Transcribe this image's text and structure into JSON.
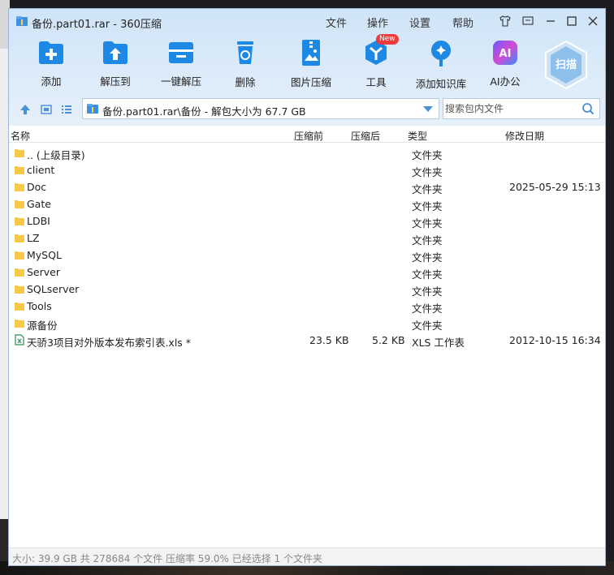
{
  "window": {
    "title": "备份.part01.rar - 360压缩",
    "menu": [
      "文件",
      "操作",
      "设置",
      "帮助"
    ]
  },
  "toolbar": {
    "items": [
      {
        "label": "添加",
        "icon": "add-icon"
      },
      {
        "label": "解压到",
        "icon": "extract-to-icon"
      },
      {
        "label": "一键解压",
        "icon": "one-click-extract-icon"
      },
      {
        "label": "删除",
        "icon": "trash-icon"
      },
      {
        "label": "图片压缩",
        "icon": "image-compress-icon"
      },
      {
        "label": "工具",
        "icon": "tools-icon"
      },
      {
        "label": "添加知识库",
        "icon": "knowledge-base-icon"
      },
      {
        "label": "AI办公",
        "icon": "ai-office-icon"
      }
    ],
    "new_badge": "New",
    "scan_label": "扫描",
    "ai_glyph": "AI"
  },
  "address": {
    "path": "备份.part01.rar\\备份 - 解包大小为 67.7 GB",
    "search_placeholder": "搜索包内文件"
  },
  "columns": [
    "名称",
    "压缩前",
    "压缩后",
    "类型",
    "修改日期"
  ],
  "files": [
    {
      "name": ".. (上级目录)",
      "before": "",
      "after": "",
      "type": "文件夹",
      "date": "",
      "kind": "folder"
    },
    {
      "name": "client",
      "before": "",
      "after": "",
      "type": "文件夹",
      "date": "",
      "kind": "folder"
    },
    {
      "name": "Doc",
      "before": "",
      "after": "",
      "type": "文件夹",
      "date": "2025-05-29 15:13",
      "kind": "folder"
    },
    {
      "name": "Gate",
      "before": "",
      "after": "",
      "type": "文件夹",
      "date": "",
      "kind": "folder"
    },
    {
      "name": "LDBI",
      "before": "",
      "after": "",
      "type": "文件夹",
      "date": "",
      "kind": "folder"
    },
    {
      "name": "LZ",
      "before": "",
      "after": "",
      "type": "文件夹",
      "date": "",
      "kind": "folder"
    },
    {
      "name": "MySQL",
      "before": "",
      "after": "",
      "type": "文件夹",
      "date": "",
      "kind": "folder"
    },
    {
      "name": "Server",
      "before": "",
      "after": "",
      "type": "文件夹",
      "date": "",
      "kind": "folder"
    },
    {
      "name": "SQLserver",
      "before": "",
      "after": "",
      "type": "文件夹",
      "date": "",
      "kind": "folder"
    },
    {
      "name": "Tools",
      "before": "",
      "after": "",
      "type": "文件夹",
      "date": "",
      "kind": "folder"
    },
    {
      "name": "源备份",
      "before": "",
      "after": "",
      "type": "文件夹",
      "date": "",
      "kind": "folder"
    },
    {
      "name": "天骄3项目对外版本发布索引表.xls *",
      "before": "23.5 KB",
      "after": "5.2 KB",
      "type": "XLS 工作表",
      "date": "2012-10-15 16:34",
      "kind": "xls"
    }
  ],
  "status": "大小: 39.9 GB 共 278684 个文件 压缩率 59.0% 已经选择 1 个文件夹",
  "colors": {
    "accent": "#1e88e5",
    "folder": "#f7c948",
    "scan": "#8fc0ec"
  }
}
